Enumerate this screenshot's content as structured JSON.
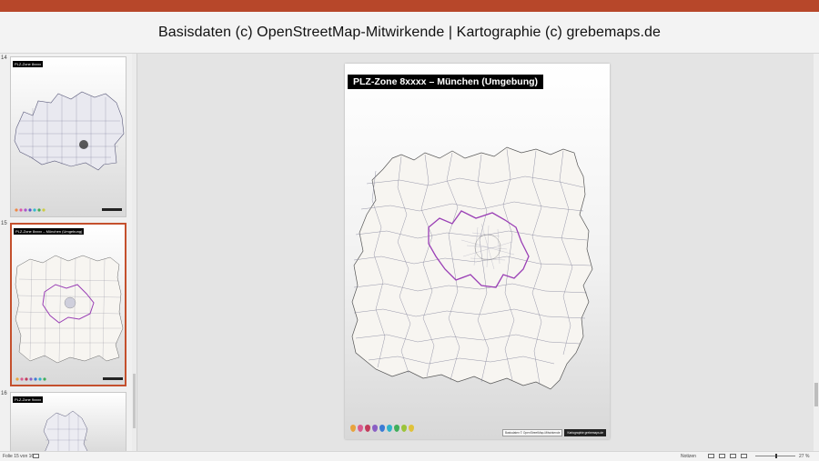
{
  "header": {
    "caption": "Basisdaten (c) OpenStreetMap-Mitwirkende | Kartographie (c) grebemaps.de"
  },
  "thumbnails": [
    {
      "number": "14",
      "title": "PLZ-Zone 8xxxx"
    },
    {
      "number": "15",
      "title": "PLZ-Zone 8xxxx – München (Umgebung)"
    },
    {
      "number": "16",
      "title": "PLZ-Zone 9xxxx"
    }
  ],
  "slide": {
    "title": "PLZ-Zone 8xxxx – München (Umgebung)",
    "credit_left": "Basisdaten © OpenStreetMap-Mitwirkende",
    "credit_right": "Kartographie grebemaps.de",
    "pin_colors": [
      "#e8a33d",
      "#d95b8f",
      "#c23b5a",
      "#8a5fc4",
      "#3a7bd5",
      "#2fb3c9",
      "#3fae5a",
      "#9bc43a",
      "#e0c23a"
    ]
  },
  "colors": {
    "accent": "#b7472a",
    "active_thumb": "#c4502d",
    "city_boundary": "#9a3fb5",
    "region_fill": "#f7f5f1"
  },
  "status": {
    "slide_counter": "Folie 15 von 16",
    "notes": "Notizen",
    "zoom": "27 %"
  }
}
